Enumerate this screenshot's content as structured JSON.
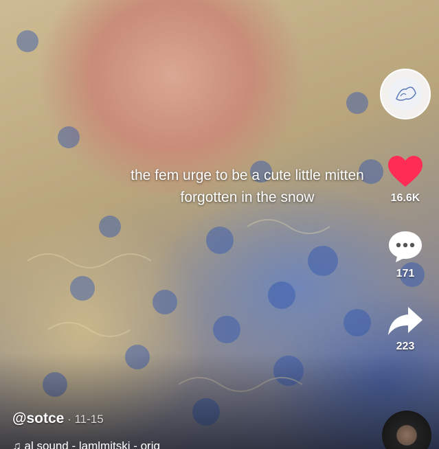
{
  "post": {
    "caption": "the fem urge to be a cute little mitten forgotten in the snow",
    "username": "@sotce",
    "date_sep": " · ",
    "date": "11-15"
  },
  "actions": {
    "likes": "16.6K",
    "comments": "171",
    "shares": "223"
  },
  "sound": {
    "text": "al sound - lamlmitski - orig"
  },
  "icons": {
    "like": "heart-icon",
    "comment": "speech-bubble-icon",
    "share": "share-arrow-icon",
    "sound": "music-note-icon",
    "disc": "spinning-disc-icon"
  },
  "colors": {
    "heart": "#ff2d55",
    "text": "#ffffff"
  }
}
